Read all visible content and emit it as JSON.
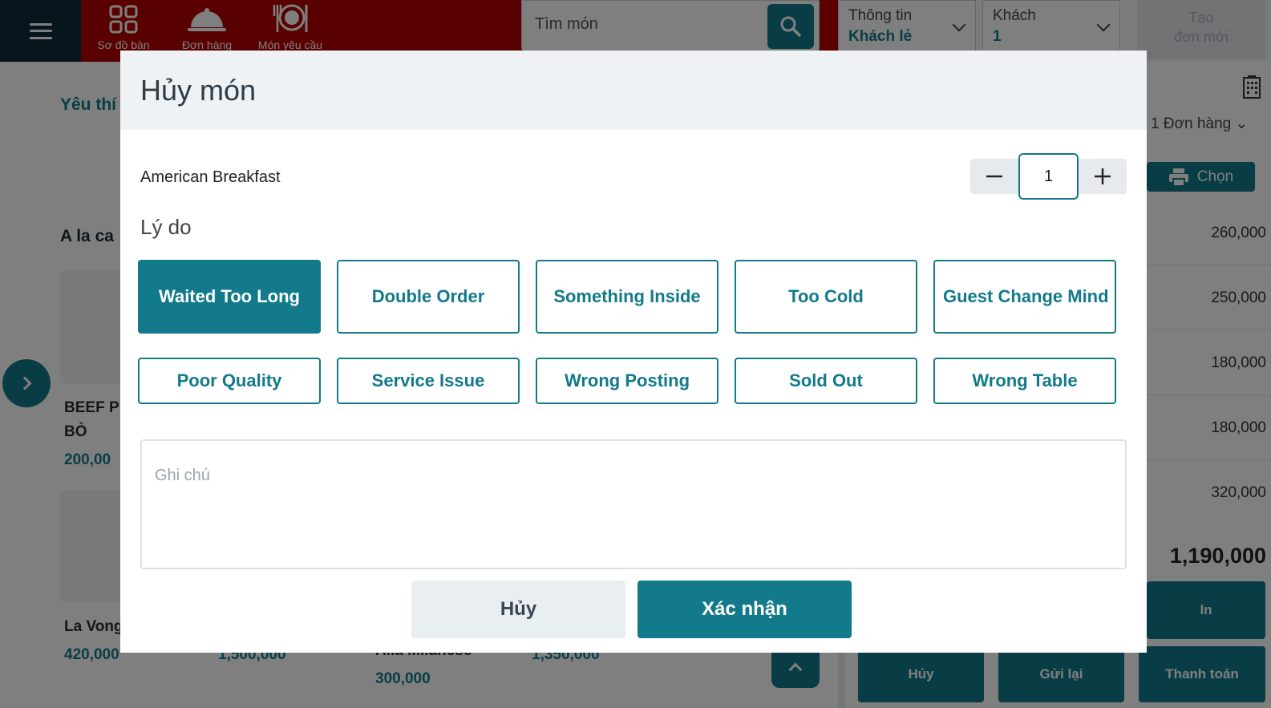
{
  "nav": {
    "items": [
      {
        "label": "Sơ đồ bàn",
        "icon": "table-grid-icon"
      },
      {
        "label": "Đơn hàng",
        "icon": "cloche-icon"
      },
      {
        "label": "Món yêu cầu",
        "icon": "dish-icon"
      }
    ]
  },
  "search": {
    "placeholder": "Tìm món"
  },
  "customer_info": {
    "label": "Thông tin",
    "value": "Khách lẻ"
  },
  "guests": {
    "label": "Khách",
    "value": "1"
  },
  "new_order": {
    "line1": "Tạo",
    "line2": "đơn mới"
  },
  "menu": {
    "favorites_title": "Yêu thí",
    "alacarte_title": "A la ca",
    "items": [
      {
        "name_line1": "BEEF P",
        "name_line2": "BÒ",
        "price": "200,00"
      },
      {
        "name": "La Vong",
        "price": "420,000"
      },
      {
        "price": "1,500,000"
      },
      {
        "name": "Alla Milanese",
        "price": "300,000"
      },
      {
        "price": "1,350,000"
      }
    ]
  },
  "order_panel": {
    "orders_dropdown": "1 Đơn hàng",
    "print_label": "Chọn",
    "line_prices": [
      "260,000",
      "250,000",
      "180,000",
      "180,000",
      "320,000"
    ],
    "total": "1,190,000",
    "print_button": "In",
    "cancel_button": "Hủy",
    "resend_button": "Gửi lại",
    "pay_button": "Thanh toán"
  },
  "modal": {
    "title": "Hủy món",
    "item_name": "American Breakfast",
    "quantity": "1",
    "reason_label": "Lý do",
    "reasons": [
      {
        "label": "Waited Too Long",
        "selected": true
      },
      {
        "label": "Double Order",
        "selected": false
      },
      {
        "label": "Something Inside",
        "selected": false
      },
      {
        "label": "Too Cold",
        "selected": false
      },
      {
        "label": "Guest Change Mind",
        "selected": false
      },
      {
        "label": "Poor Quality",
        "selected": false
      },
      {
        "label": "Service Issue",
        "selected": false
      },
      {
        "label": "Wrong Posting",
        "selected": false
      },
      {
        "label": "Sold Out",
        "selected": false
      },
      {
        "label": "Wrong Table",
        "selected": false
      }
    ],
    "note_placeholder": "Ghi chú",
    "cancel_label": "Hủy",
    "confirm_label": "Xác nhận"
  },
  "colors": {
    "accent": "#127a8a",
    "topbar": "#b30000",
    "menu_bg": "#0f2d3a"
  }
}
